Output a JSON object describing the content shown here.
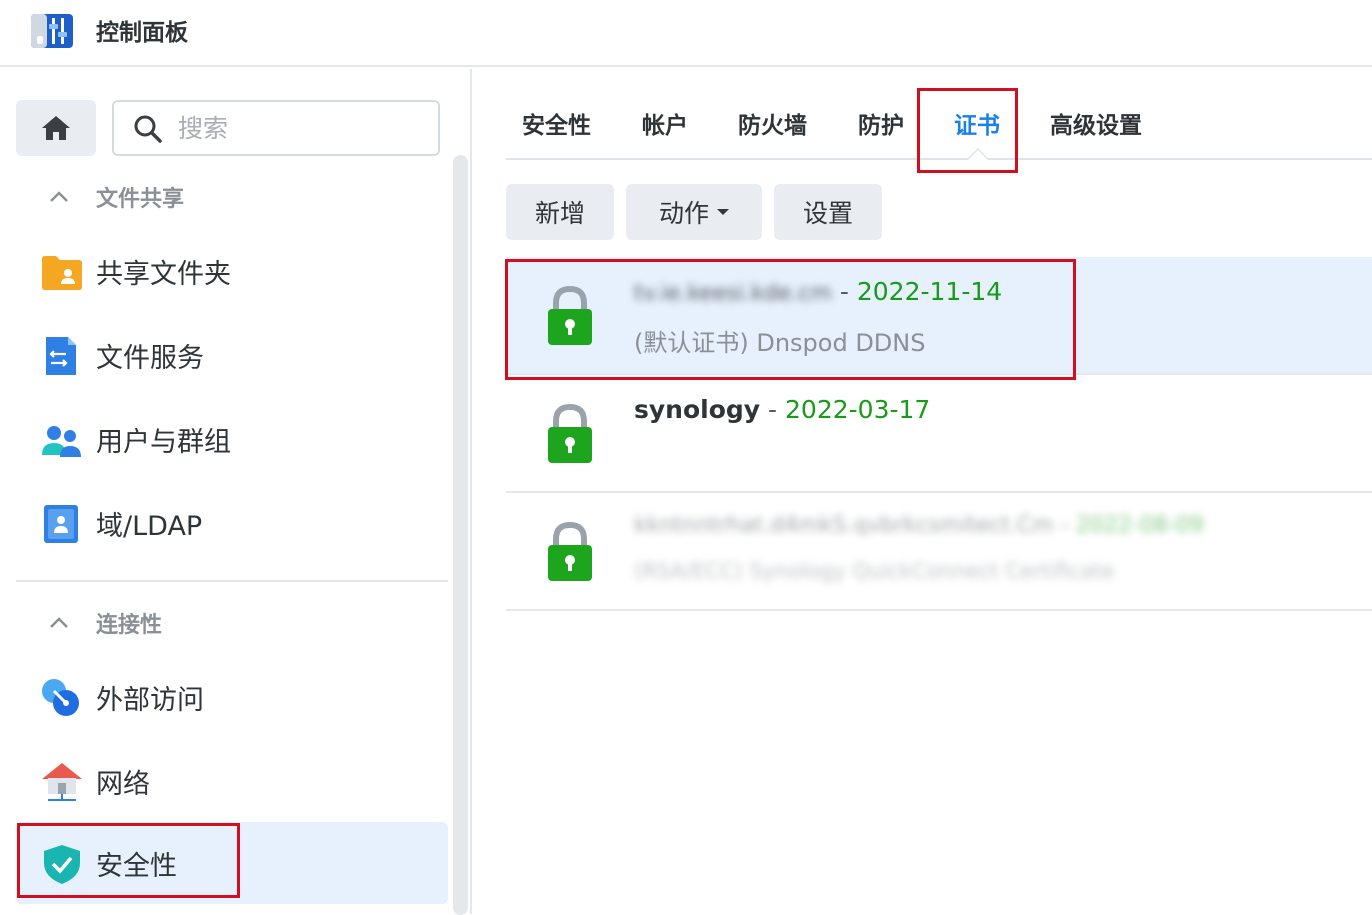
{
  "app": {
    "title": "控制面板"
  },
  "sidebar": {
    "search_placeholder": "搜索",
    "sections": [
      {
        "label": "文件共享"
      },
      {
        "label": "连接性"
      }
    ],
    "items": [
      {
        "label": "共享文件夹",
        "icon": "shared-folder-icon"
      },
      {
        "label": "文件服务",
        "icon": "file-services-icon"
      },
      {
        "label": "用户与群组",
        "icon": "users-groups-icon"
      },
      {
        "label": "域/LDAP",
        "icon": "domain-ldap-icon"
      },
      {
        "label": "外部访问",
        "icon": "external-access-icon"
      },
      {
        "label": "网络",
        "icon": "network-icon"
      },
      {
        "label": "安全性",
        "icon": "shield-check-icon",
        "active": true
      }
    ]
  },
  "tabs": [
    {
      "label": "安全性"
    },
    {
      "label": "帐户"
    },
    {
      "label": "防火墙"
    },
    {
      "label": "防护"
    },
    {
      "label": "证书",
      "active": true
    },
    {
      "label": "高级设置"
    }
  ],
  "toolbar": {
    "add_label": "新增",
    "action_label": "动作",
    "settings_label": "设置"
  },
  "certificates": [
    {
      "name": "tv.ie.keesi.kde.cm",
      "separator": " - ",
      "expiry": "2022-11-14",
      "description": "(默认证书) Dnspod DDNS",
      "blurred_name": true,
      "selected": true
    },
    {
      "name": "synology",
      "separator": " - ",
      "expiry": "2022-03-17",
      "description": ""
    },
    {
      "name": "kkntnntrhat.d4mkS.qvbrkcsmitect.Cm",
      "separator": " - ",
      "expiry": "2022-08-09",
      "description": "(RSA/ECC) Synology QuickConnect Certificate",
      "blurred": true
    }
  ],
  "colors": {
    "accent": "#1a81e8",
    "date_green": "#1a9a1a",
    "lock_green": "#1ea51e",
    "highlight_red": "#d0101e",
    "selected_bg": "#e6f1fd"
  }
}
